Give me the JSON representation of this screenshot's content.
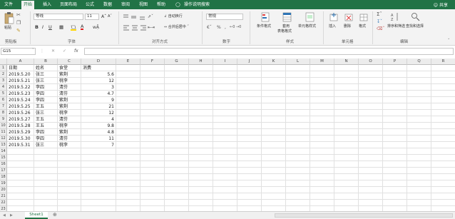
{
  "menu": {
    "tabs": [
      "文件",
      "开始",
      "插入",
      "页面布局",
      "公式",
      "数据",
      "审阅",
      "视图",
      "帮助",
      "操作说明搜索"
    ],
    "share": "共享"
  },
  "ribbon": {
    "clipboard": {
      "paste": "粘贴",
      "label": "剪贴板"
    },
    "font": {
      "name": "等线",
      "size": "11",
      "label": "字体"
    },
    "alignment": {
      "wrap": "自动换行",
      "merge": "合并后居中",
      "label": "对齐方式"
    },
    "number": {
      "format": "常规",
      "label": "数字"
    },
    "styles": {
      "conditional": "条件格式",
      "table_line1": "套用",
      "table_line2": "表格格式",
      "cell_styles": "单元格样式",
      "label": "样式"
    },
    "cells": {
      "insert": "插入",
      "delete": "删除",
      "format": "格式",
      "label": "单元格"
    },
    "editing": {
      "sort": "排序和筛选",
      "find": "查找和选择",
      "label": "编辑"
    }
  },
  "formula_bar": {
    "name_box": "G15",
    "fx": "fx",
    "value": ""
  },
  "columns": [
    "A",
    "B",
    "C",
    "D",
    "E",
    "F",
    "G",
    "H",
    "I",
    "J",
    "K",
    "L",
    "M",
    "N",
    "O",
    "P",
    "Q",
    "R"
  ],
  "rows": [
    "1",
    "2",
    "3",
    "4",
    "5",
    "6",
    "7",
    "8",
    "9",
    "10",
    "11",
    "12",
    "13",
    "14",
    "15",
    "16",
    "17",
    "18",
    "19",
    "20",
    "21",
    "22",
    "23"
  ],
  "table": {
    "headers": [
      "日期",
      "姓名",
      "食堂",
      "消费"
    ],
    "rows": [
      [
        "2019.5.20",
        "张三",
        "紫荆",
        "5.6"
      ],
      [
        "2019.5.21",
        "张三",
        "桃李",
        "12"
      ],
      [
        "2019.5.22",
        "李四",
        "清芬",
        "3"
      ],
      [
        "2019.5.23",
        "李四",
        "清芬",
        "4.7"
      ],
      [
        "2019.5.24",
        "李四",
        "紫荆",
        "9"
      ],
      [
        "2019.5.25",
        "王五",
        "紫荆",
        "21"
      ],
      [
        "2019.5.26",
        "张三",
        "桃李",
        "12"
      ],
      [
        "2019.5.27",
        "王五",
        "清芬",
        "4"
      ],
      [
        "2019.5.28",
        "王五",
        "桃李",
        "9.8"
      ],
      [
        "2019.5.29",
        "李四",
        "紫荆",
        "4.8"
      ],
      [
        "2019.5.30",
        "李四",
        "清芬",
        "11"
      ],
      [
        "2019.5.31",
        "张三",
        "桃李",
        "7"
      ]
    ]
  },
  "sheet": {
    "tab": "Sheet1"
  },
  "colors": {
    "accent": "#217346"
  }
}
